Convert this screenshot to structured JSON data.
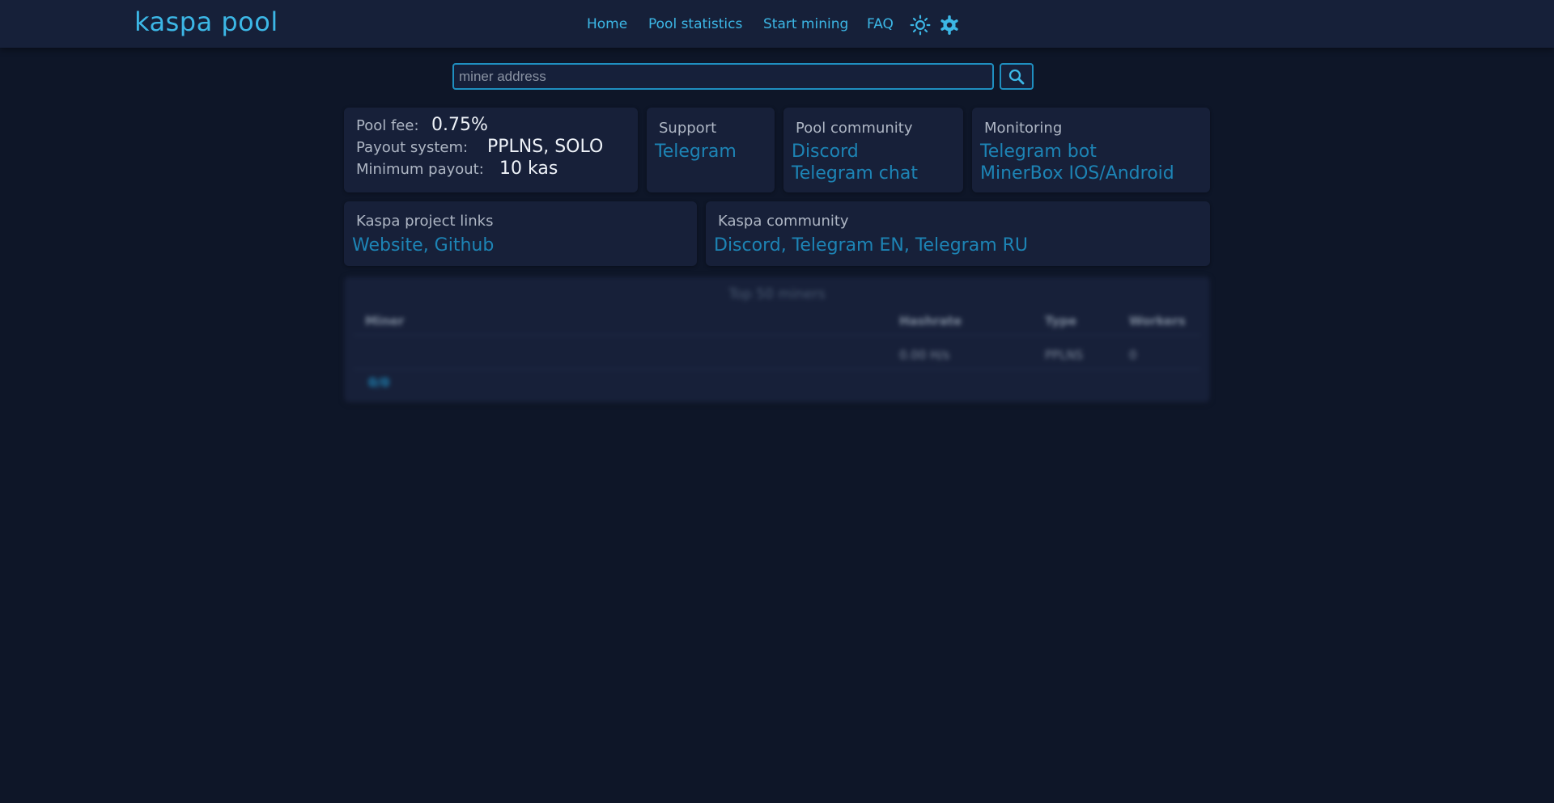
{
  "header": {
    "brand": "kaspa pool",
    "nav": {
      "home": "Home",
      "pool_statistics": "Pool statistics",
      "start_mining": "Start mining",
      "faq": "FAQ"
    },
    "icons": {
      "theme": "sun-icon",
      "settings": "gear-icon"
    }
  },
  "search": {
    "placeholder": "miner address",
    "value": "",
    "button_icon": "search-icon"
  },
  "pool_info": {
    "fee_label": "Pool fee:",
    "fee_value": "0.75%",
    "payout_label": "Payout system:",
    "payout_value": "PPLNS, SOLO",
    "min_payout_label": "Minimum payout:",
    "min_payout_value": "10 kas"
  },
  "support": {
    "title": "Support",
    "links": [
      "Telegram"
    ]
  },
  "pool_community": {
    "title": "Pool community",
    "links": [
      "Discord",
      "Telegram chat"
    ]
  },
  "monitoring": {
    "title": "Monitoring",
    "links": [
      "Telegram bot",
      "MinerBox IOS/Android"
    ]
  },
  "project_links": {
    "title": "Kaspa project links",
    "links_text": "Website, Github"
  },
  "kaspa_community": {
    "title": "Kaspa community",
    "links_text": "Discord, Telegram EN, Telegram RU"
  },
  "top_miners": {
    "title": "Top 50 miners",
    "columns": [
      "Miner",
      "Hashrate",
      "Type",
      "Workers"
    ],
    "rows": [
      {
        "miner": "",
        "hashrate": "0.00 H/s",
        "type": "PPLNS",
        "workers": "0"
      }
    ],
    "pagination": "0/0"
  },
  "colors": {
    "background": "#0e1628",
    "panel": "#172039",
    "accent": "#3cb7e6",
    "link": "#1d84b5"
  }
}
